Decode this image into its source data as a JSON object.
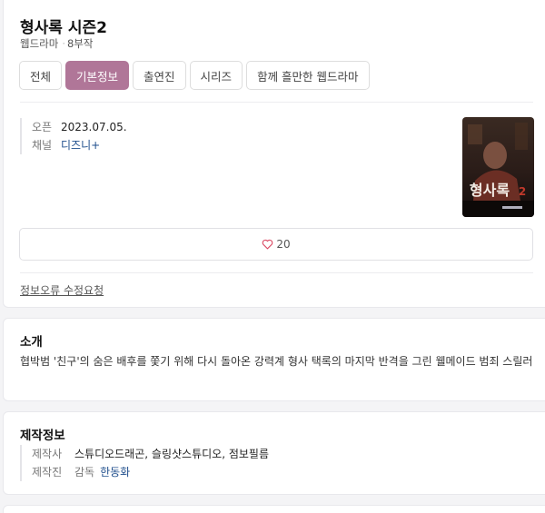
{
  "header": {
    "title": "형사록 시즌2",
    "genre": "웹드라마",
    "separator": "·",
    "episodes": "8부작"
  },
  "tabs": [
    {
      "label": "전체",
      "active": false
    },
    {
      "label": "기본정보",
      "active": true
    },
    {
      "label": "출연진",
      "active": false
    },
    {
      "label": "시리즈",
      "active": false
    },
    {
      "label": "함께 흘만한 웹드라마",
      "active": false
    }
  ],
  "info": {
    "open_key": "오픈",
    "open_value": "2023.07.05.",
    "channel_key": "채널",
    "channel_value": "디즈니+"
  },
  "poster": {
    "icon": "poster-image",
    "title_text": "형사록",
    "title_suffix": "2"
  },
  "like": {
    "icon": "heart-icon",
    "count": "20"
  },
  "report_link": "정보오류 수정요청",
  "intro": {
    "title": "소개",
    "text": "협박범 '친구'의 숨은 배후를 쫓기 위해 다시 돌아온 강력계 형사 택록의 마지막 반격을 그린 웰메이드 범죄 스릴러"
  },
  "production": {
    "title": "제작정보",
    "studio_key": "제작사",
    "studio_value": "스튜디오드래곤, 슬링샷스튜디오, 점보필름",
    "staff_key": "제작진",
    "staff_role": "감독",
    "staff_name": "한동화"
  },
  "colors": {
    "accent": "#b07698",
    "link": "#1f4e8c",
    "heart": "#d9455f"
  }
}
